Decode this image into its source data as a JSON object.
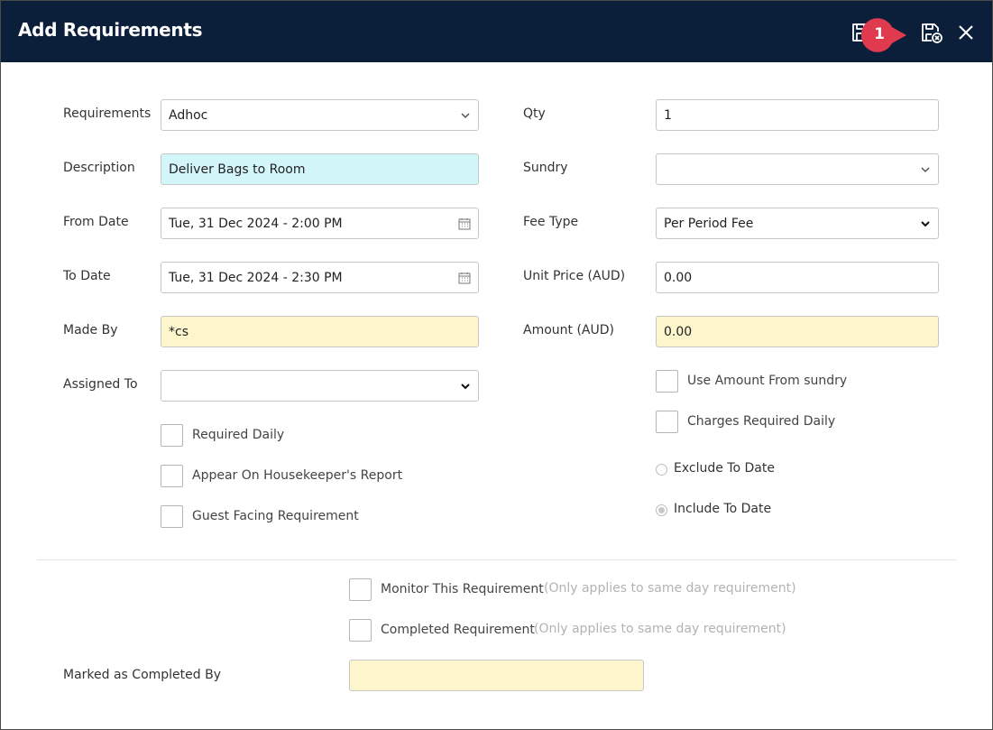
{
  "window": {
    "title": "Add Requirements",
    "callout_number": "1",
    "colors": {
      "titlebar": "#0c1f3a",
      "callout": "#e03a4e",
      "cyan_field": "#d3f6fb",
      "yellow_field": "#fdf6cc"
    }
  },
  "toolbar": {
    "icons": [
      "save-icon",
      "save-close-icon",
      "close-icon"
    ]
  },
  "left": {
    "requirements": {
      "label": "Requirements",
      "value": "Adhoc"
    },
    "description": {
      "label": "Description",
      "value": "Deliver Bags to Room"
    },
    "from_date": {
      "label": "From Date",
      "value": "Tue, 31 Dec 2024 - 2:00 PM"
    },
    "to_date": {
      "label": "To Date",
      "value": "Tue, 31 Dec 2024 - 2:30 PM"
    },
    "made_by": {
      "label": "Made By",
      "value": "*cs"
    },
    "assigned_to": {
      "label": "Assigned To",
      "value": ""
    },
    "checkboxes": [
      {
        "label": "Required Daily",
        "checked": false
      },
      {
        "label": "Appear On Housekeeper's Report",
        "checked": false
      },
      {
        "label": "Guest Facing Requirement",
        "checked": false
      }
    ]
  },
  "right": {
    "qty": {
      "label": "Qty",
      "value": "1"
    },
    "sundry": {
      "label": "Sundry",
      "value": ""
    },
    "fee_type": {
      "label": "Fee Type",
      "value": "Per Period Fee"
    },
    "unit_price": {
      "label": "Unit Price (AUD)",
      "value": "0.00"
    },
    "amount": {
      "label": "Amount (AUD)",
      "value": "0.00"
    },
    "checkboxes": [
      {
        "label": "Use Amount From sundry",
        "checked": false
      },
      {
        "label": "Charges Required Daily",
        "checked": false
      }
    ],
    "radios": [
      {
        "label": "Exclude To Date",
        "checked": false
      },
      {
        "label": "Include To Date",
        "checked": true
      }
    ]
  },
  "bottom": {
    "monitor": {
      "label": "Monitor This Requirement",
      "note": "(Only applies to same day requirement)",
      "checked": false
    },
    "completed": {
      "label": "Completed Requirement",
      "note": "(Only applies to same day requirement)",
      "checked": false
    },
    "marked_by": {
      "label": "Marked as Completed By",
      "value": ""
    }
  }
}
